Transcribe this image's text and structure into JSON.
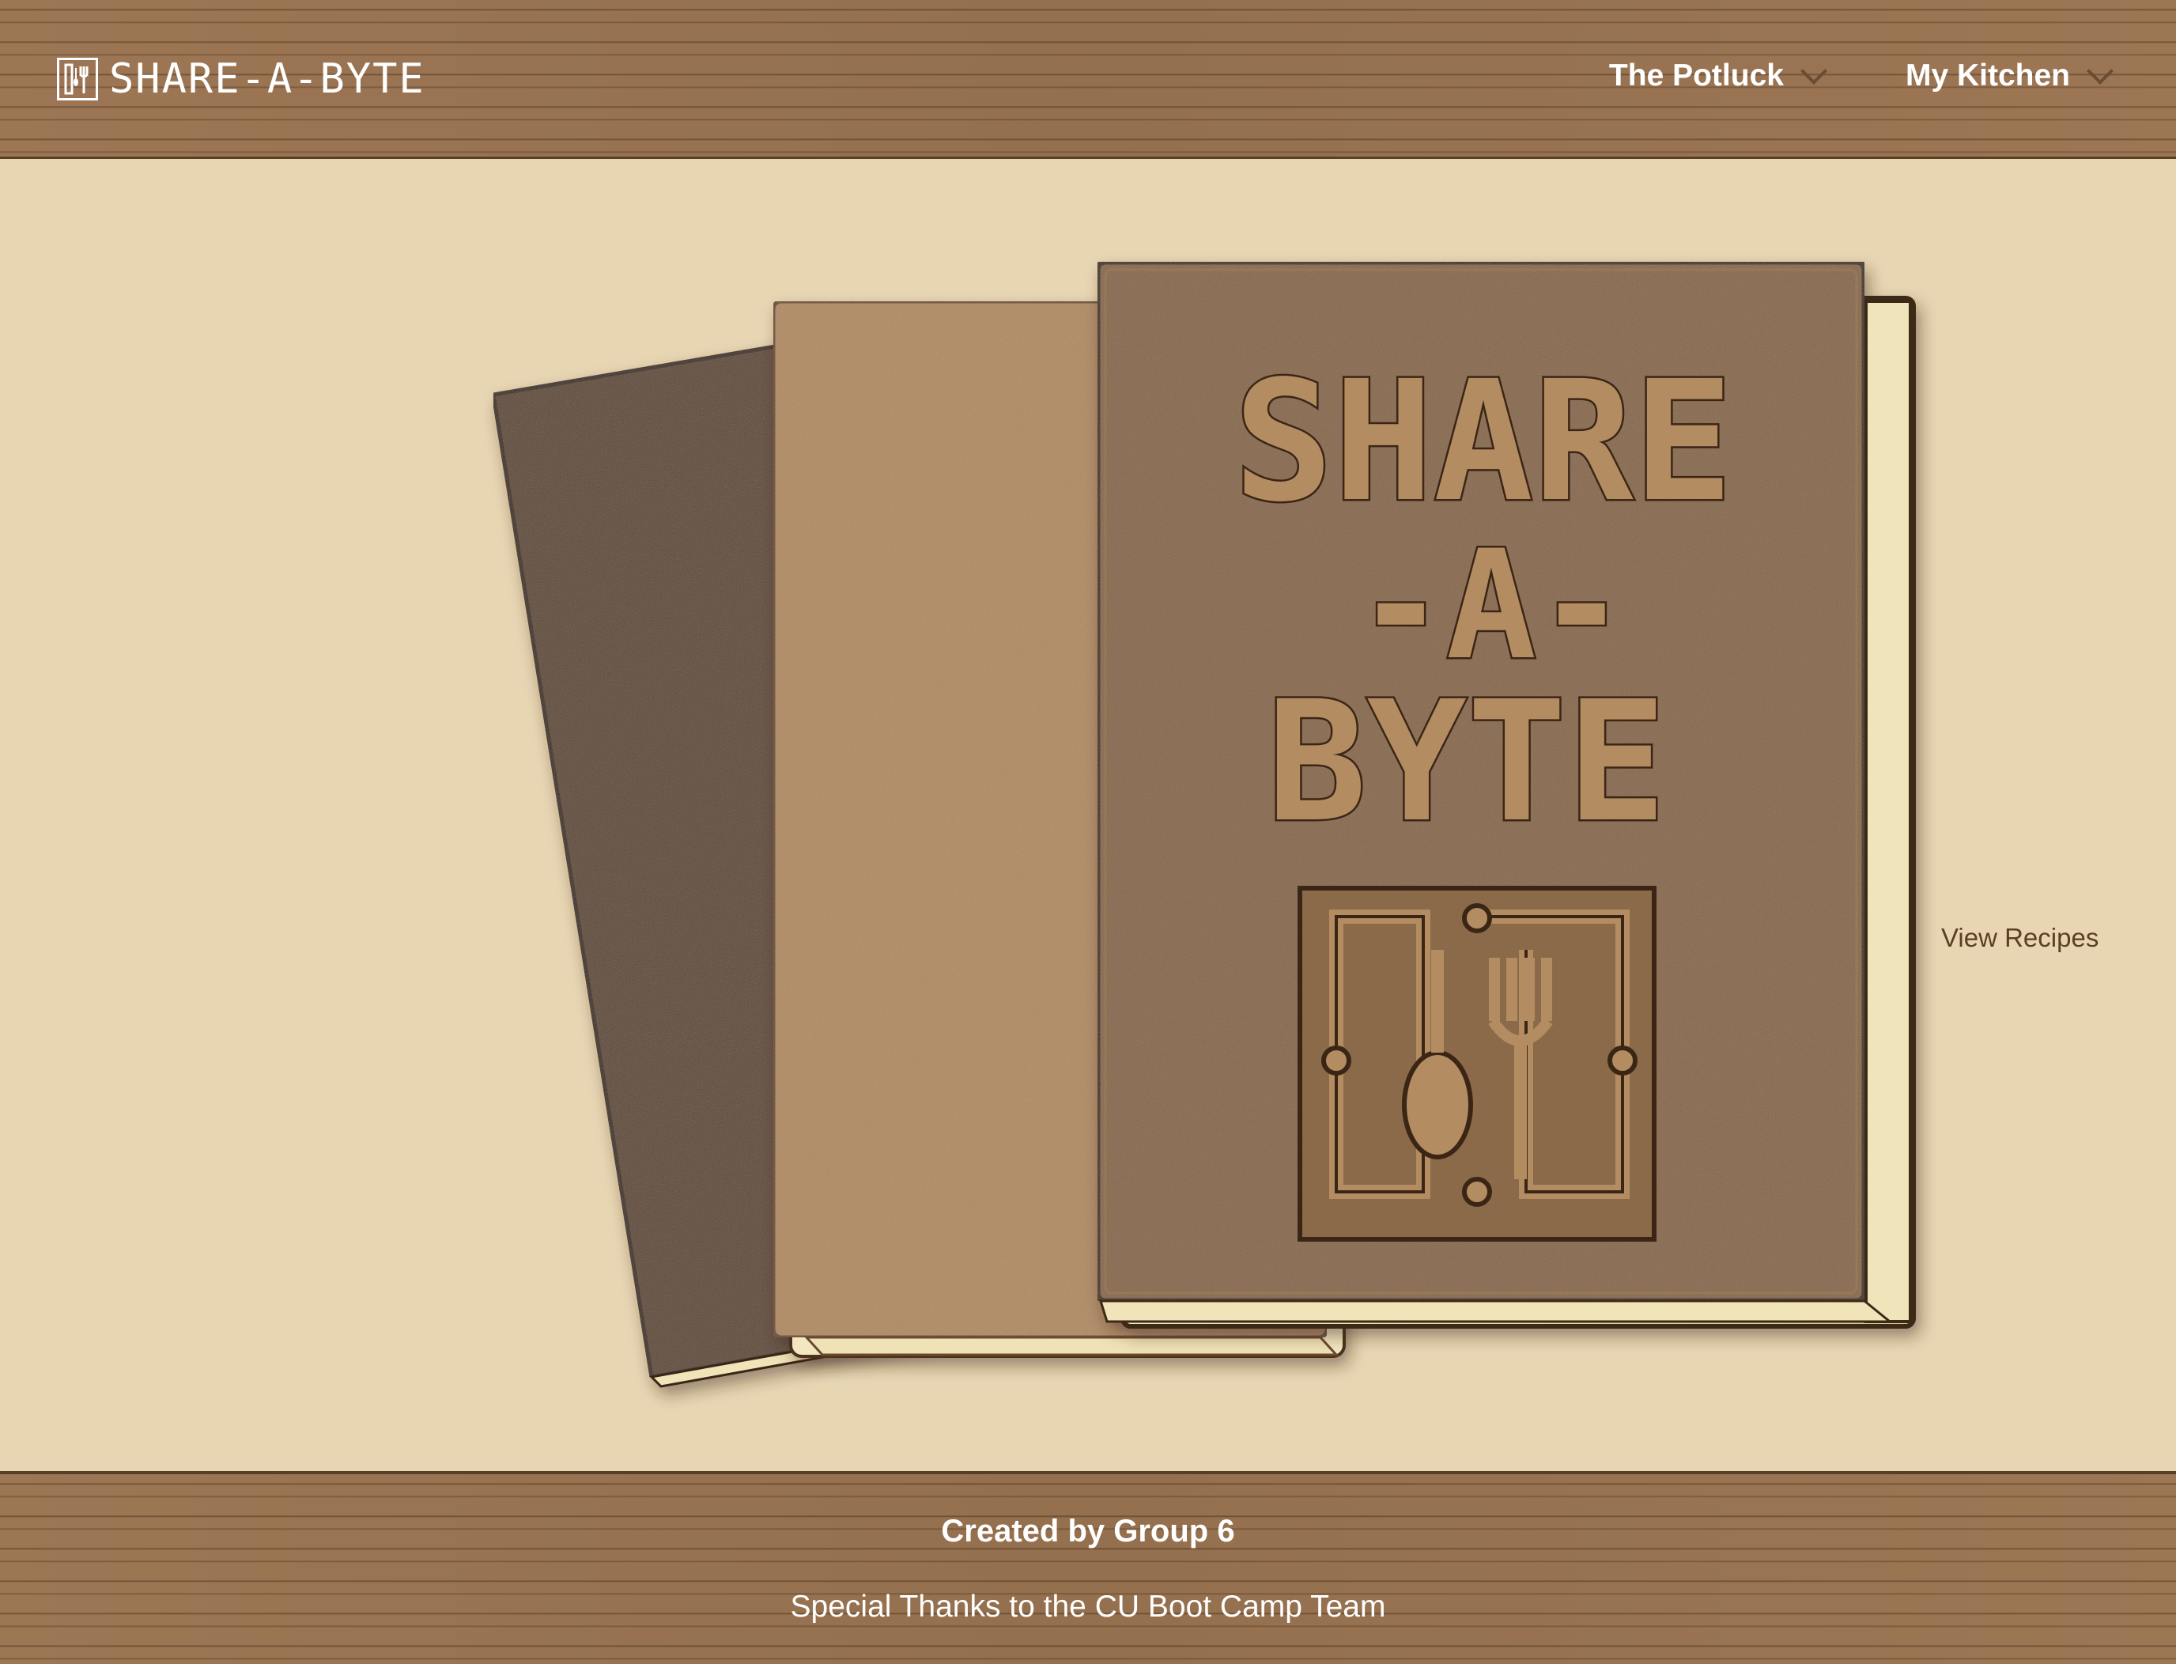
{
  "header": {
    "logo_text": "SHARE-A-BYTE",
    "nav": [
      {
        "label": "The Potluck"
      },
      {
        "label": "My Kitchen"
      }
    ]
  },
  "hero": {
    "cover_title_lines": [
      "SHARE",
      "-A-",
      "BYTE"
    ],
    "view_recipes_label": "View Recipes"
  },
  "footer": {
    "created_by": "Created by Group 6",
    "thanks": "Special Thanks to the CU Boot Camp Team"
  },
  "colors": {
    "background": "#e8d6b3",
    "wood": "#9a7452",
    "book_dark": "#5f4630",
    "book_light": "#b08a60",
    "book_front": "#876647",
    "link_text": "#5a3e26"
  }
}
